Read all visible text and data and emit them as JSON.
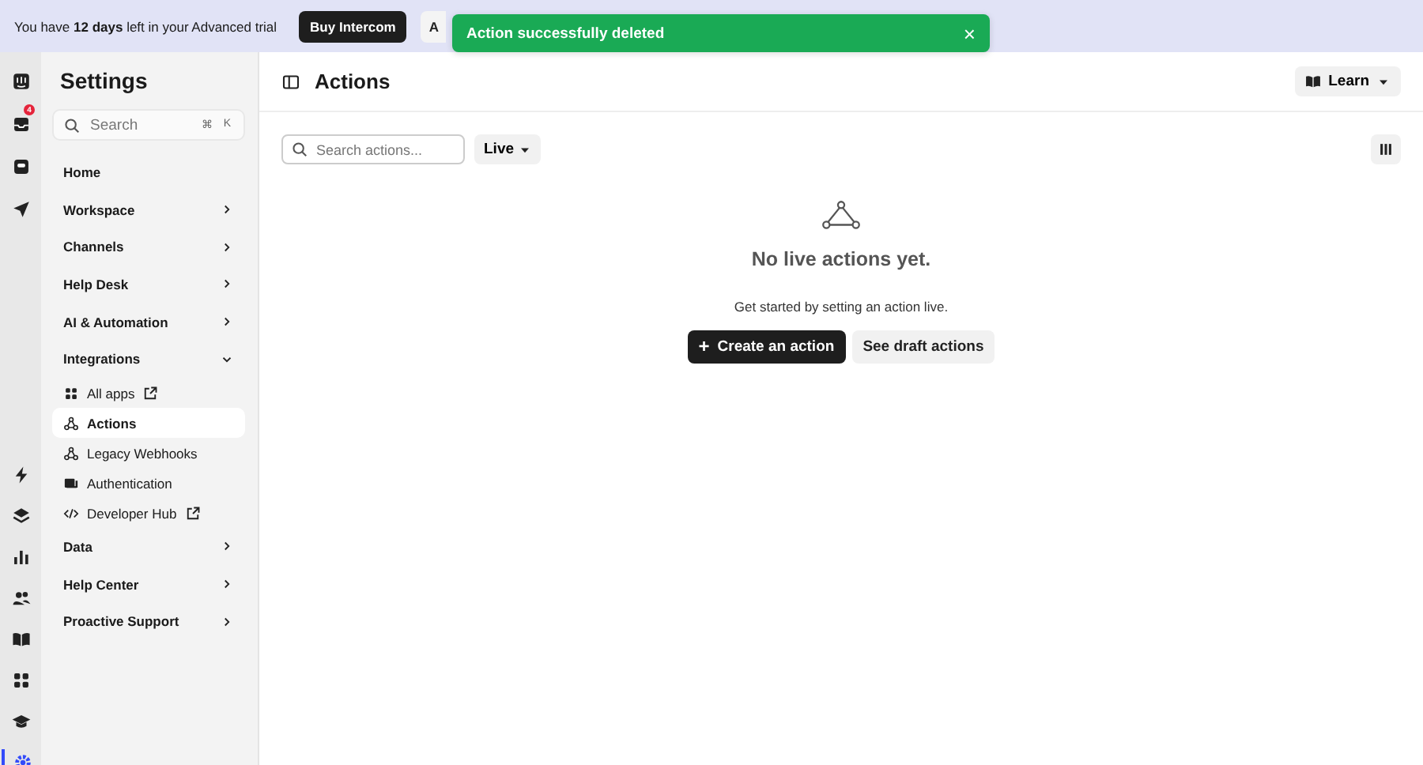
{
  "trial_banner": {
    "message": "You have **12 days** left in your Advanced trial",
    "buttons": [
      {
        "label": "Buy Intercom",
        "kind": "primary"
      },
      {
        "label": "A",
        "kind": "secondary"
      }
    ]
  },
  "toast": {
    "message": "Action successfully deleted",
    "close": "×"
  },
  "rail": {
    "top": [
      {
        "selected": false
      },
      {
        "selected": false,
        "badge": "4"
      },
      {
        "selected": false
      },
      {
        "selected": false
      }
    ],
    "bottom": [
      {
        "selected": false
      },
      {
        "selected": false
      },
      {
        "selected": false
      },
      {
        "selected": false
      },
      {
        "selected": false
      },
      {
        "selected": false
      },
      {
        "selected": false
      },
      {
        "selected": true
      }
    ]
  },
  "sidebar": {
    "title": "Settings",
    "search": {
      "placeholder": "Search",
      "shortcut": [
        "⌘",
        "K"
      ]
    },
    "items": [
      {
        "label": "Home",
        "kind": "link"
      },
      {
        "label": "Workspace",
        "kind": "group",
        "expanded": false
      },
      {
        "label": "Channels",
        "kind": "group",
        "expanded": false
      },
      {
        "label": "Help Desk",
        "kind": "group",
        "expanded": false
      },
      {
        "label": "AI & Automation",
        "kind": "group",
        "expanded": false
      },
      {
        "label": "Integrations",
        "kind": "group",
        "expanded": true,
        "children": [
          {
            "label": "All apps",
            "external": true,
            "selected": false
          },
          {
            "label": "Actions",
            "external": false,
            "selected": true
          },
          {
            "label": "Legacy Webhooks",
            "external": false,
            "selected": false
          },
          {
            "label": "Authentication",
            "external": false,
            "selected": false
          },
          {
            "label": "Developer Hub",
            "external": true,
            "selected": false
          }
        ]
      },
      {
        "label": "Data",
        "kind": "group",
        "expanded": false
      },
      {
        "label": "Help Center",
        "kind": "group",
        "expanded": false
      },
      {
        "label": "Proactive Support",
        "kind": "group",
        "expanded": false
      }
    ]
  },
  "header": {
    "title": "Actions",
    "learn": "Learn"
  },
  "toolbar": {
    "search": {
      "placeholder": "Search actions..."
    },
    "filter": "Live"
  },
  "empty_state": {
    "title": "No live actions yet.",
    "text": "Get started by setting an action live.",
    "buttons": [
      {
        "label": "Create an action",
        "kind": "primary",
        "icon": "+"
      },
      {
        "label": "See draft actions",
        "kind": "secondary"
      }
    ]
  }
}
